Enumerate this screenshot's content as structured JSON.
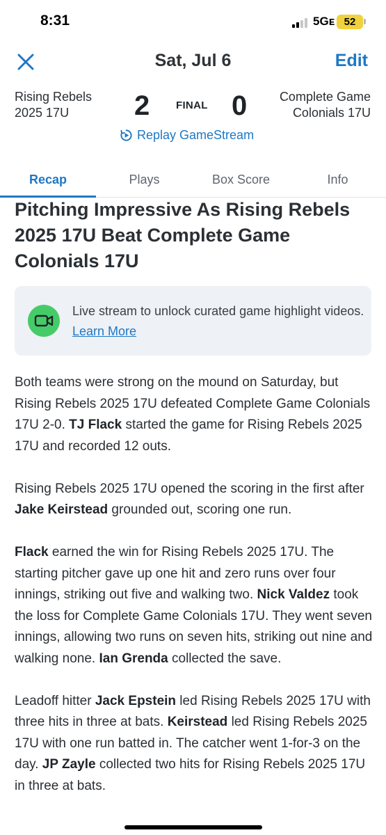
{
  "status_bar": {
    "time": "8:31",
    "network": "5Gᴇ",
    "battery": "52"
  },
  "header": {
    "close_icon": "close-icon",
    "title": "Sat, Jul 6",
    "edit_label": "Edit"
  },
  "scoreboard": {
    "home_team_line1": "Rising Rebels",
    "home_team_line2": "2025 17U",
    "home_score": "2",
    "status": "FINAL",
    "away_score": "0",
    "away_team_line1": "Complete Game",
    "away_team_line2": "Colonials 17U",
    "replay_label": "Replay GameStream"
  },
  "tabs": [
    {
      "label": "Recap",
      "active": true
    },
    {
      "label": "Plays",
      "active": false
    },
    {
      "label": "Box Score",
      "active": false
    },
    {
      "label": "Info",
      "active": false
    }
  ],
  "recap": {
    "headline": "Pitching Impressive As Rising Rebels 2025 17U Beat Complete Game Colonials 17U",
    "banner_text": "Live stream to unlock curated game highlight videos.",
    "banner_link": "Learn More",
    "paragraphs": [
      [
        {
          "t": "Both teams were strong on the mound on Saturday, but Rising Rebels 2025 17U defeated Complete Game Colonials 17U 2-0. "
        },
        {
          "t": "TJ Flack",
          "b": true
        },
        {
          "t": " started the game for Rising Rebels 2025 17U and recorded 12 outs."
        }
      ],
      [
        {
          "t": "Rising Rebels 2025 17U opened the scoring in the first after "
        },
        {
          "t": "Jake Keirstead",
          "b": true
        },
        {
          "t": " grounded out, scoring one run."
        }
      ],
      [
        {
          "t": "Flack",
          "b": true
        },
        {
          "t": " earned the win for Rising Rebels 2025 17U. The starting pitcher gave up one hit and zero runs over four innings, striking out five and walking two. "
        },
        {
          "t": "Nick Valdez",
          "b": true
        },
        {
          "t": " took the loss for Complete Game Colonials 17U. They went seven innings, allowing two runs on seven hits, striking out nine and walking none. "
        },
        {
          "t": "Ian Grenda",
          "b": true
        },
        {
          "t": " collected the save."
        }
      ],
      [
        {
          "t": "Leadoff hitter "
        },
        {
          "t": "Jack Epstein",
          "b": true
        },
        {
          "t": " led Rising Rebels 2025 17U with three hits in three at bats. "
        },
        {
          "t": "Keirstead",
          "b": true
        },
        {
          "t": " led Rising Rebels 2025 17U with one run batted in. The catcher went 1-for-3 on the day. "
        },
        {
          "t": "JP Zayle",
          "b": true
        },
        {
          "t": " collected two hits for Rising Rebels 2025 17U in three at bats."
        }
      ]
    ]
  },
  "colors": {
    "accent": "#1f78c4",
    "banner_bg": "#eef1f5",
    "video_icon_bg": "#45cc68",
    "battery": "#f0d23c"
  }
}
